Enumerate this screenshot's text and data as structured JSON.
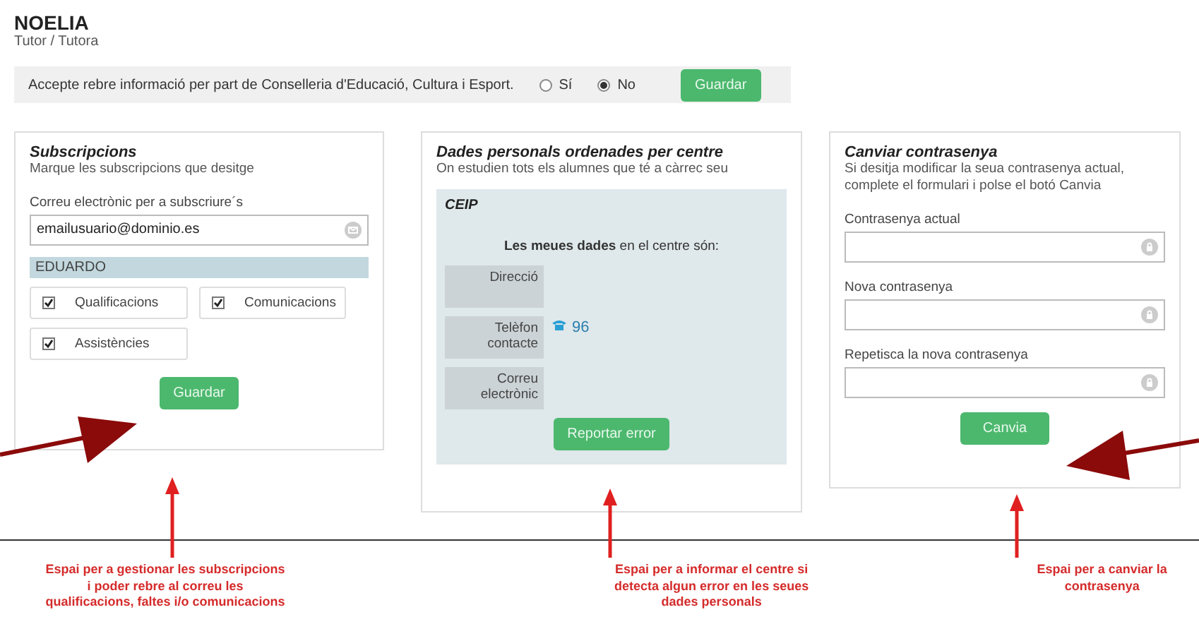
{
  "user": {
    "name": "NOELIA",
    "role": "Tutor / Tutora"
  },
  "consent": {
    "text": "Accepte rebre informació per part de Conselleria d'Educació, Cultura i Esport.",
    "options": [
      {
        "label": "Sí",
        "selected": false
      },
      {
        "label": "No",
        "selected": true
      }
    ],
    "button": "Guardar"
  },
  "subscriptions": {
    "title": "Subscripcions",
    "subtitle": "Marque les subscripcions que desitge",
    "email_label": "Correu electrònic per a subscriure´s",
    "email_value": "emailusuario@dominio.es",
    "student": "EDUARDO",
    "options": [
      {
        "label": "Qualificacions",
        "checked": true
      },
      {
        "label": "Comunicacions",
        "checked": true
      },
      {
        "label": "Assistències",
        "checked": true
      }
    ],
    "button": "Guardar"
  },
  "personal": {
    "title": "Dades personals ordenades per centre",
    "subtitle": "On estudien tots els alumnes que té a càrrec seu",
    "centre": "CEIP",
    "intro": "**Les meues dades** en el centre són:",
    "rows": [
      {
        "label": "Direcció"
      },
      {
        "label": "Telèfon contacte",
        "value": "96"
      },
      {
        "label": "Correu electrònic"
      }
    ],
    "button": "Reportar error"
  },
  "password": {
    "title": "Canviar contrasenya",
    "subtitle": "Si desitja modificar la seua contrasenya actual, complete el formulari i polse el botó Canvia",
    "fields": [
      {
        "label": "Contrasenya actual"
      },
      {
        "label": "Nova contrasenya"
      },
      {
        "label": "Repetisca la nova contrasenya"
      }
    ],
    "button": "Canvia"
  },
  "notes": [
    "Espai per a gestionar les subscripcions i poder rebre al correu les qualificacions, faltes i/o comunicacions",
    "Espai per a informar el centre si detecta algun error en les seues dades personals",
    "Espai per a canviar la contrasenya"
  ]
}
